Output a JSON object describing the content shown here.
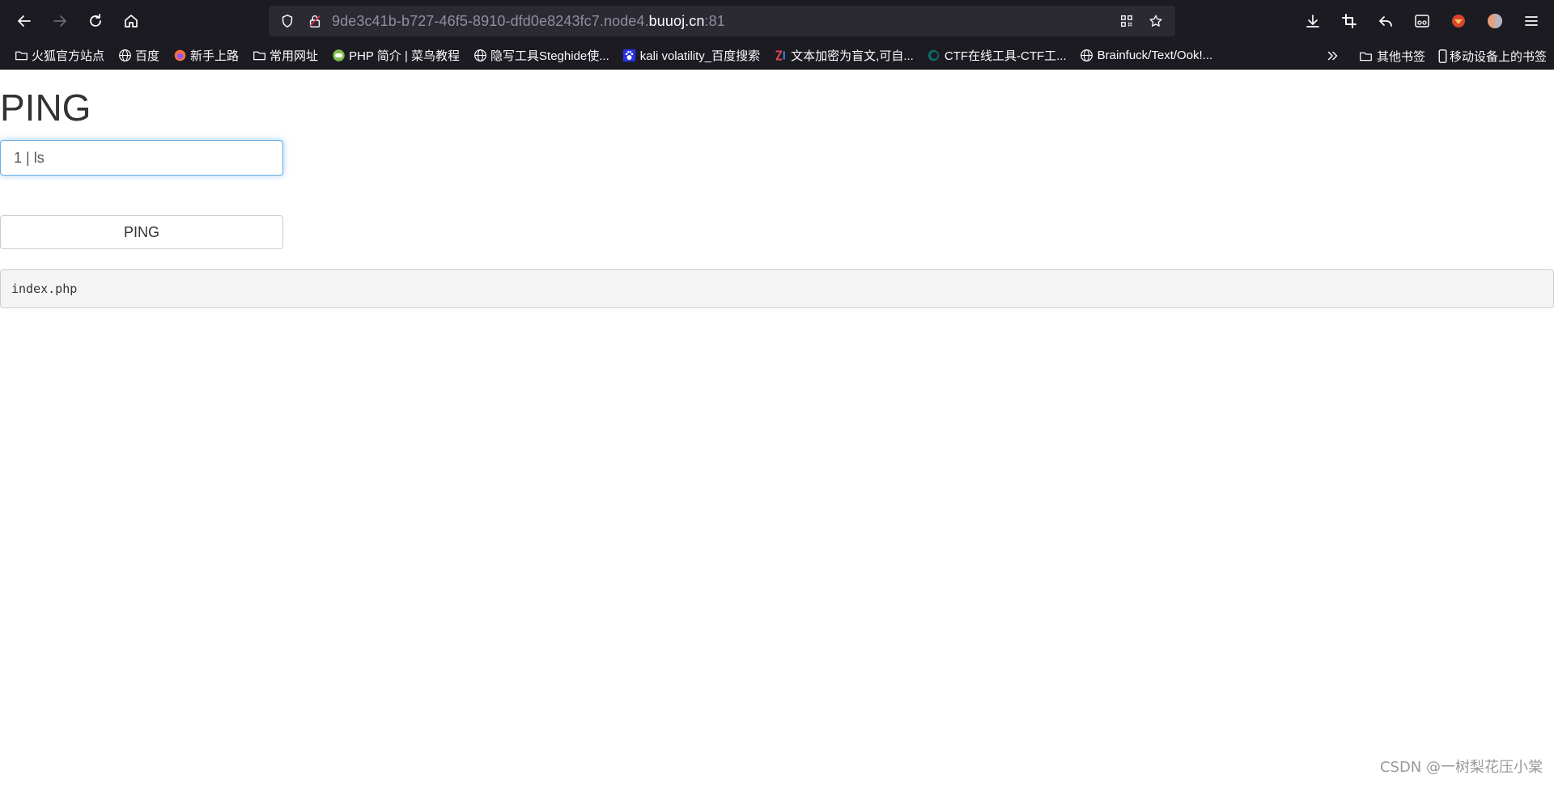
{
  "browser": {
    "url_prefix": "9de3c41b-b727-46f5-8910-dfd0e8243fc7.node4.",
    "url_host": "buuoj.cn",
    "url_port": ":81"
  },
  "bookmarks": [
    {
      "label": "火狐官方站点",
      "icon": "folder-icon"
    },
    {
      "label": "百度",
      "icon": "globe-icon"
    },
    {
      "label": "新手上路",
      "icon": "firefox-icon"
    },
    {
      "label": "常用网址",
      "icon": "folder-icon"
    },
    {
      "label": "PHP 简介 | 菜鸟教程",
      "icon": "runoob-icon"
    },
    {
      "label": "隐写工具Steghide使...",
      "icon": "globe-icon"
    },
    {
      "label": "kali volatility_百度搜索",
      "icon": "baidu-paw-icon"
    },
    {
      "label": "文本加密为盲文,可自...",
      "icon": "zi-icon"
    },
    {
      "label": "CTF在线工具-CTF工...",
      "icon": "ctf-icon"
    },
    {
      "label": "Brainfuck/Text/Ook!...",
      "icon": "globe-icon"
    }
  ],
  "bookmarks_right": {
    "other_label": "其他书签",
    "mobile_label": "移动设备上的书签"
  },
  "page": {
    "title": "PING",
    "input_value": "1 | ls",
    "button_label": "PING",
    "output_text": "index.php"
  },
  "watermark": "CSDN @一树梨花压小棠",
  "colors": {
    "chrome_bg": "#1c1b22",
    "urlbar_bg": "#2b2a33",
    "input_focus": "#66afe9",
    "output_bg": "#f5f5f5"
  }
}
